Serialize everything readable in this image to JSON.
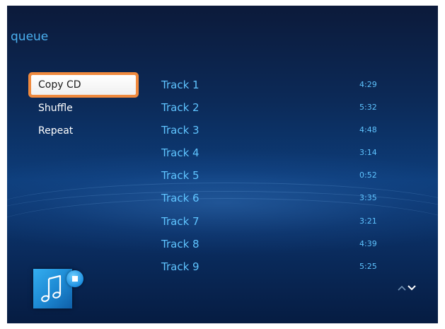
{
  "header": {
    "title": "queue"
  },
  "menu": {
    "items": [
      {
        "label": "Copy CD",
        "selected": true
      },
      {
        "label": "Shuffle",
        "selected": false
      },
      {
        "label": "Repeat",
        "selected": false
      }
    ]
  },
  "tracks": [
    {
      "name": "Track 1",
      "duration": "4:29"
    },
    {
      "name": "Track 2",
      "duration": "5:32"
    },
    {
      "name": "Track 3",
      "duration": "4:48"
    },
    {
      "name": "Track 4",
      "duration": "3:14"
    },
    {
      "name": "Track 5",
      "duration": "0:52"
    },
    {
      "name": "Track 6",
      "duration": "3:35"
    },
    {
      "name": "Track 7",
      "duration": "3:21"
    },
    {
      "name": "Track 8",
      "duration": "4:39"
    },
    {
      "name": "Track 9",
      "duration": "5:25"
    }
  ],
  "icons": {
    "album": "music-note-icon",
    "playback": "stop-icon",
    "scroll_up": "chevron-up-icon",
    "scroll_down": "chevron-down-icon"
  },
  "colors": {
    "accent": "#5fc4ff",
    "title": "#4bb0f0",
    "focus_ring": "#f08a3e",
    "background": "#0d3d7a"
  }
}
